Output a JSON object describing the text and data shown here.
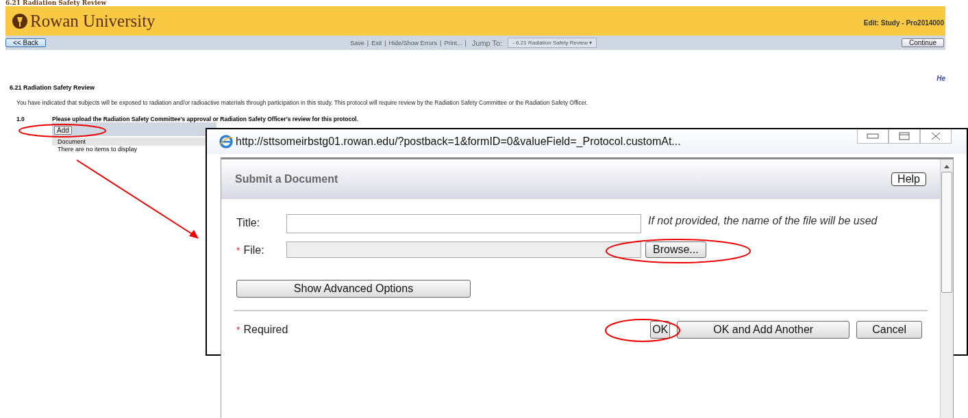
{
  "page_heading": "6.21 Radiation Safety Review",
  "header": {
    "logo_text": "Rowan University",
    "context": "Edit: Study - Pro2014000"
  },
  "toolbar": {
    "back": "<< Back",
    "links": [
      "Save",
      "Exit",
      "Hide/Show Errors",
      "Print..."
    ],
    "separator": "|",
    "jump_arrow": "▾",
    "jump_label": "Jump To:",
    "jump_value": "- 6.21 Radiation Safety Review",
    "continue": "Continue"
  },
  "help_link": "He",
  "section": {
    "title": "6.21 Radiation Safety Review",
    "intro": "You have indicated that subjects will be exposed to radiation and/or radioactive materials through participation in this study.  This protocol will require review by the Radiation Safety Committee or the Radiation Safety Officer.",
    "question": {
      "number": "1.0",
      "text": "Please upload the Radiation Safety Committee's approval or Radiation Safety Officer's review for this protocol.",
      "add": "Add",
      "column": "Document",
      "empty": "There are no items to display"
    }
  },
  "popup": {
    "url": "http://sttsomeirbstg01.rowan.edu/?postback=1&formID=0&valueField=_Protocol.customAt...",
    "dialog_title": "Submit a Document",
    "required_mark": "*",
    "help": "Help",
    "fields": [
      {
        "label": "Title:",
        "required": false,
        "kind": "text",
        "hint": "If not provided, the name of the file will be used"
      },
      {
        "label": "File:",
        "required": true,
        "kind": "file",
        "button": "Browse..."
      }
    ],
    "advanced": "Show Advanced Options",
    "required_note": "Required",
    "buttons": [
      "OK",
      "OK and Add Another",
      "Cancel"
    ]
  }
}
